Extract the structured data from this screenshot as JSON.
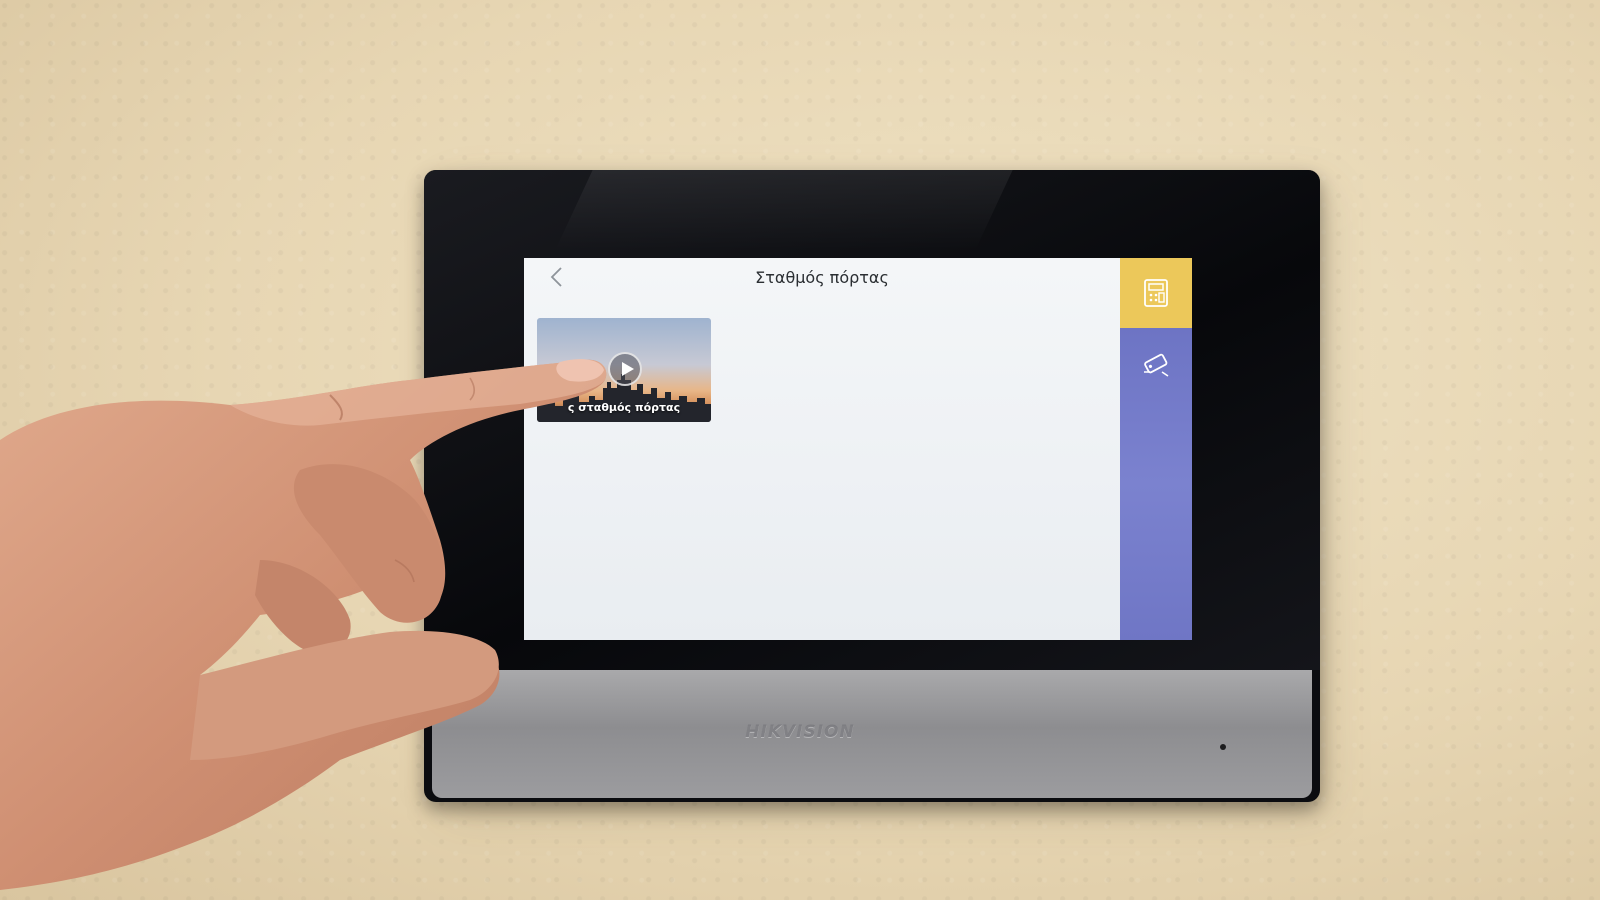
{
  "device": {
    "brand": "HIKVISION",
    "screen": {
      "title": "Σταθμός πόρτας",
      "tile_label": "ς σταθμός πόρτας",
      "side_buttons": [
        {
          "icon": "door-station-icon",
          "active": true,
          "color": "#ecc85a"
        },
        {
          "icon": "camera-icon",
          "active": false,
          "color": "#7179c8"
        }
      ]
    }
  },
  "colors": {
    "wall": "#e7d6b3",
    "screen_bg": "#eef1f4",
    "accent_yellow": "#ecc85a",
    "accent_purple": "#7179c8",
    "bezel": "#0b0c10"
  }
}
